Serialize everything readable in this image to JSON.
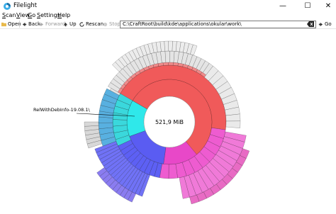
{
  "window": {
    "title": "Filelight",
    "minimize": "—",
    "maximize": "☐",
    "close": "✕"
  },
  "menu": [
    {
      "label": "Scan",
      "key": "S",
      "rest": "can"
    },
    {
      "label": "View",
      "key": "V",
      "rest": "iew"
    },
    {
      "label": "Go",
      "key": "G",
      "rest": "o"
    },
    {
      "label": "Settings",
      "key": "S",
      "rest": "ettings"
    },
    {
      "label": "Help",
      "key": "H",
      "rest": "elp"
    }
  ],
  "toolbar": {
    "open": "Open",
    "back": "Back",
    "forward": "Forward",
    "up": "Up",
    "rescan": "Rescan",
    "stop": "Stop",
    "go": "Go"
  },
  "location": {
    "path": "C:\\CraftRoot\\build\\kde\\applications\\okular\\work\\"
  },
  "radial": {
    "center_label": "521,9 MiB",
    "tooltip_label": "RelWithDebInfo-19.08.1\\"
  },
  "colors": {
    "red": "#f05a5a",
    "cyan": "#2fe8ea",
    "blue": "#5a5cf2",
    "magenta": "#e848c8",
    "grey": "#dcdcdc"
  }
}
